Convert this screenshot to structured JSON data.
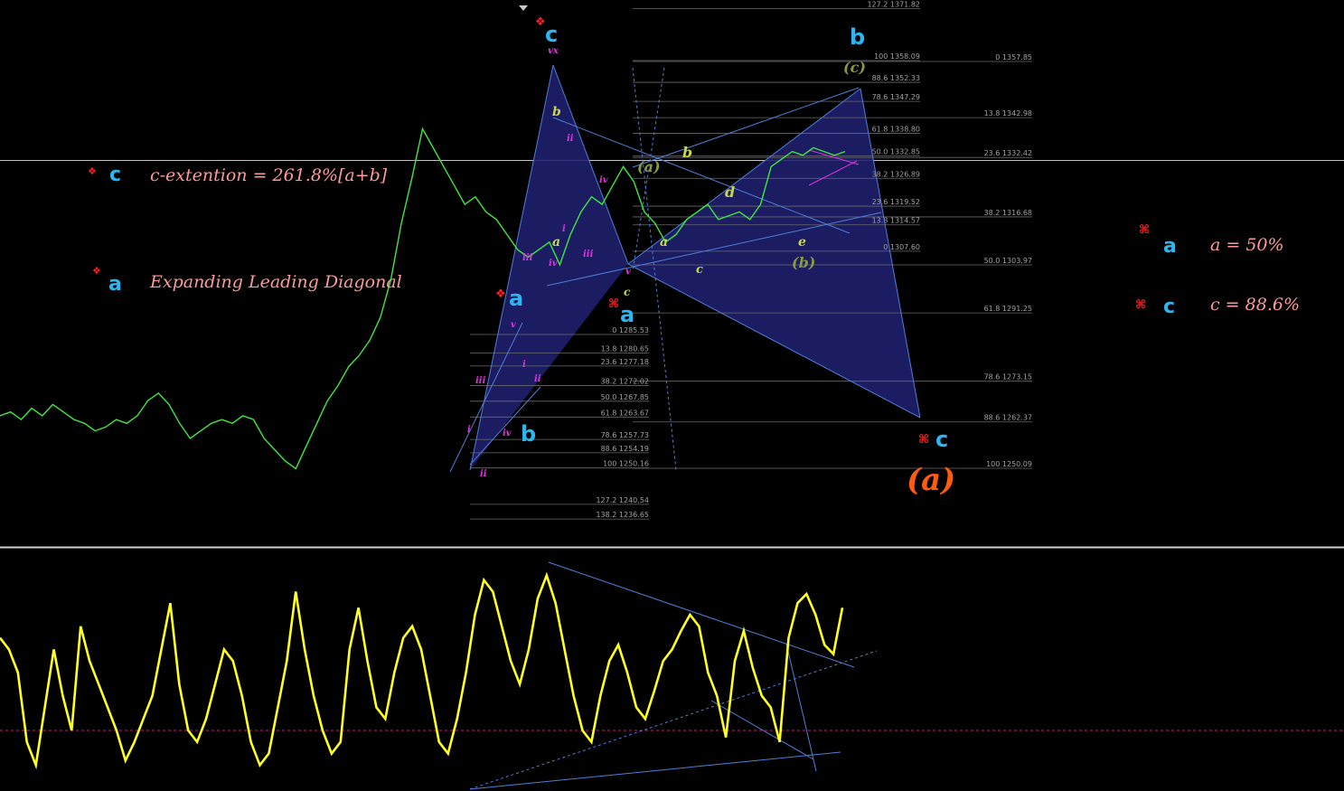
{
  "chart_data": [
    {
      "type": "line",
      "panel": "price",
      "colors": {
        "background": "#000000",
        "price": "#3ee83e",
        "pattern_fill": "#1f2070",
        "trendline": "#4f7fd8",
        "wave_primary": "#2bb6f0",
        "wave_minor": "#e030e0",
        "wave_sub": "#c8d84a",
        "wave_inter": "#8a9a40",
        "label_text": "#ff9a9a",
        "orange": "#ff5a10",
        "symbol_red": "#ff2020"
      },
      "series": [
        {
          "values": [
            1264,
            1265,
            1263,
            1266,
            1264,
            1267,
            1265,
            1263,
            1262,
            1260,
            1261,
            1263,
            1262,
            1264,
            1268,
            1270,
            1267,
            1262,
            1258,
            1260,
            1262,
            1263,
            1262,
            1264,
            1263,
            1258,
            1255,
            1252,
            1250,
            1256,
            1262,
            1268,
            1272,
            1277,
            1280,
            1284,
            1290,
            1300,
            1315,
            1327,
            1340,
            1335,
            1330,
            1325,
            1320,
            1322,
            1318,
            1316,
            1312,
            1308,
            1306,
            1308,
            1310,
            1304,
            1312,
            1318,
            1322,
            1320,
            1325,
            1330,
            1326,
            1318,
            1315,
            1310,
            1312,
            1316,
            1318,
            1320,
            1316,
            1317,
            1318,
            1316,
            1320,
            1330,
            1332,
            1334,
            1333,
            1335,
            1334,
            1333,
            1334
          ]
        }
      ],
      "fib_left": {
        "levels": [
          "127.2 1371.82",
          "100 1358.09",
          "88.6 1352.33",
          "78.6 1347.29",
          "61.8 1338.80",
          "50.0 1332.85",
          "38.2 1326.89",
          "23.6 1319.52",
          "13.8 1314.57",
          "0 1307.60"
        ]
      },
      "fib_right_upper": {
        "levels": [
          "0 1357.85",
          "13.8 1342.98",
          "23.6 1332.42",
          "38.2 1316.68",
          "50.0 1303.97",
          "61.8 1291.25",
          "78.6 1273.15",
          "88.6 1262.37",
          "100 1250.09"
        ]
      },
      "fib_lower_left": {
        "levels": [
          "0 1285.53",
          "13.8 1280.65",
          "23.6 1277.18",
          "38.2 1272.02",
          "50.0 1267.85",
          "61.8 1263.67",
          "78.6 1257.73",
          "88.6 1254.19",
          "100 1250.16",
          "127.2 1240.54",
          "138.2 1236.65"
        ]
      },
      "annotations": {
        "big_labels": [
          "c",
          "b",
          "a",
          "b",
          "a",
          "c",
          "(a)"
        ],
        "sub_labels": [
          "b",
          "a",
          "a",
          "b",
          "d",
          "c",
          "e",
          "c"
        ],
        "intermediate": [
          "(a)",
          "(c)",
          "(b)"
        ],
        "minor_numerals": [
          "vx",
          "ii",
          "i",
          "iii",
          "iv",
          "iii",
          "v",
          "iii",
          "i",
          "ii",
          "iv",
          "ii",
          "i",
          "iv",
          "v"
        ]
      }
    },
    {
      "type": "line",
      "panel": "oscillator",
      "colors": {
        "line": "#ffff20",
        "zero_line": "#c02080",
        "trendline": "#4f7fd8"
      },
      "series": [
        {
          "values": [
            65,
            60,
            50,
            20,
            10,
            35,
            60,
            40,
            25,
            70,
            55,
            45,
            35,
            25,
            12,
            20,
            30,
            40,
            60,
            80,
            45,
            25,
            20,
            30,
            45,
            60,
            55,
            40,
            20,
            10,
            15,
            35,
            55,
            85,
            60,
            40,
            25,
            15,
            20,
            60,
            78,
            55,
            35,
            30,
            50,
            65,
            70,
            60,
            40,
            20,
            15,
            30,
            50,
            75,
            90,
            85,
            70,
            55,
            45,
            60,
            82,
            92,
            80,
            60,
            40,
            25,
            20,
            40,
            55,
            62,
            50,
            35,
            30,
            42,
            55,
            60,
            68,
            75,
            70,
            50,
            40,
            22,
            55,
            68,
            52,
            40,
            35,
            20,
            65,
            80,
            84,
            75,
            62,
            58,
            78
          ]
        }
      ]
    }
  ],
  "legend": {
    "left": [
      {
        "wave": "c",
        "text": "c-extention = 261.8%[a+b]"
      },
      {
        "wave": "a",
        "text": "Expanding Leading Diagonal"
      }
    ],
    "right": [
      {
        "wave": "a",
        "text": "a = 50%"
      },
      {
        "wave": "c",
        "text": "c = 88.6%"
      }
    ]
  }
}
